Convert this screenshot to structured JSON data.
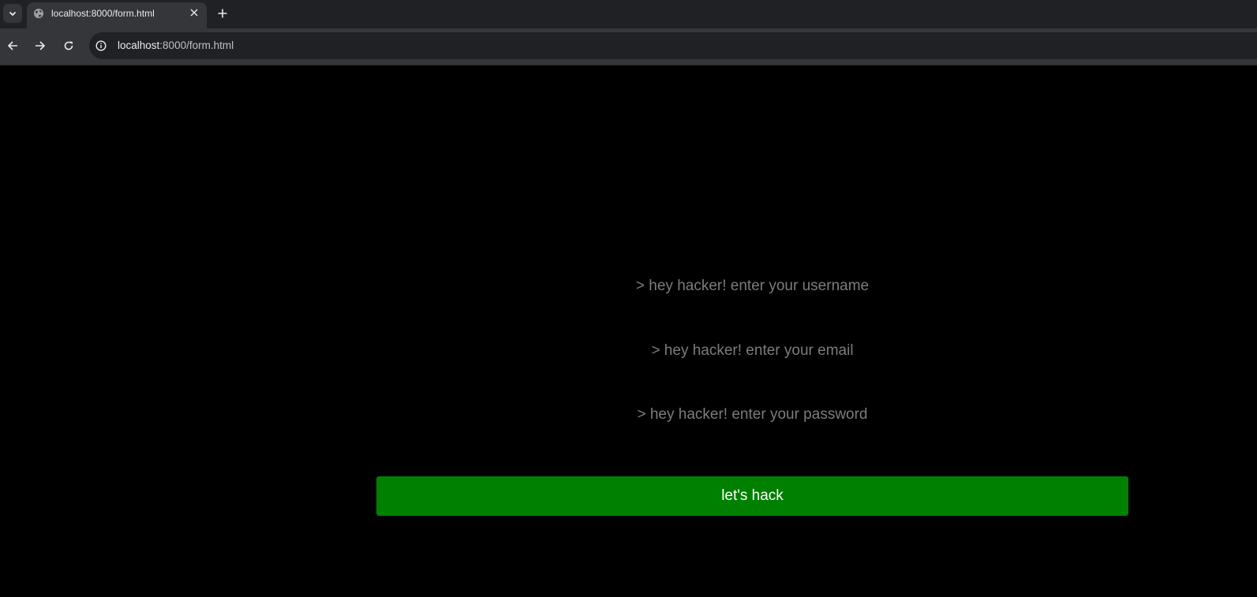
{
  "browser": {
    "tab": {
      "title": "localhost:8000/form.html",
      "favicon": "globe-icon"
    },
    "address_bar": {
      "host": "localhost",
      "path": ":8000/form.html"
    },
    "icons": {
      "tab_search": "chevron-down-icon",
      "tab_close": "close-icon",
      "new_tab": "plus-icon",
      "back": "arrow-left-icon",
      "forward": "arrow-right-icon",
      "reload": "reload-icon",
      "site_info": "info-icon"
    }
  },
  "form": {
    "username": {
      "placeholder": "> hey hacker! enter your username",
      "value": ""
    },
    "email": {
      "placeholder": "> hey hacker! enter your email",
      "value": ""
    },
    "password": {
      "placeholder": "> hey hacker! enter your password",
      "value": ""
    },
    "submit_label": "let's hack"
  },
  "colors": {
    "page_background": "#000000",
    "button_background": "#008000",
    "button_text": "#ffffff",
    "placeholder_text": "#7c7c7c"
  }
}
